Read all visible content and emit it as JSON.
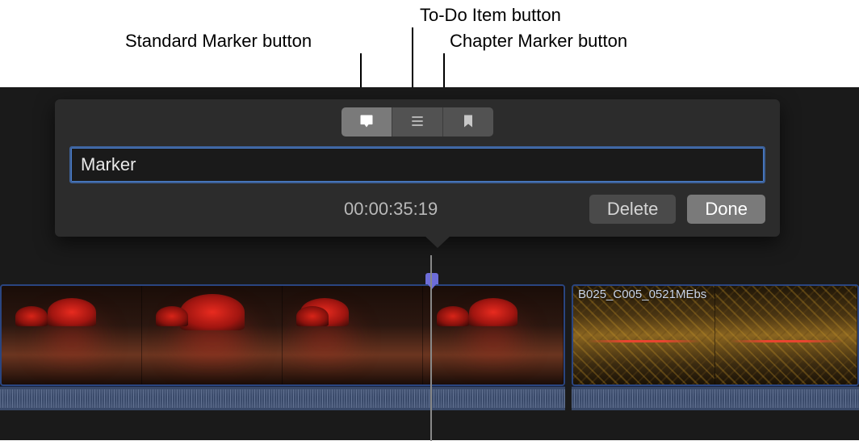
{
  "callouts": {
    "standard": "Standard Marker button",
    "todo": "To-Do Item button",
    "chapter": "Chapter Marker button"
  },
  "popover": {
    "marker_name": "Marker",
    "timecode": "00:00:35:19",
    "delete_label": "Delete",
    "done_label": "Done",
    "icons": {
      "standard": "standard-marker-icon",
      "todo": "todo-icon",
      "chapter": "chapter-icon"
    }
  },
  "timeline": {
    "clip2_label": "B025_C005_0521MEbs"
  },
  "colors": {
    "focus_ring": "#3d6199",
    "marker_pin": "#6d6dd8"
  }
}
